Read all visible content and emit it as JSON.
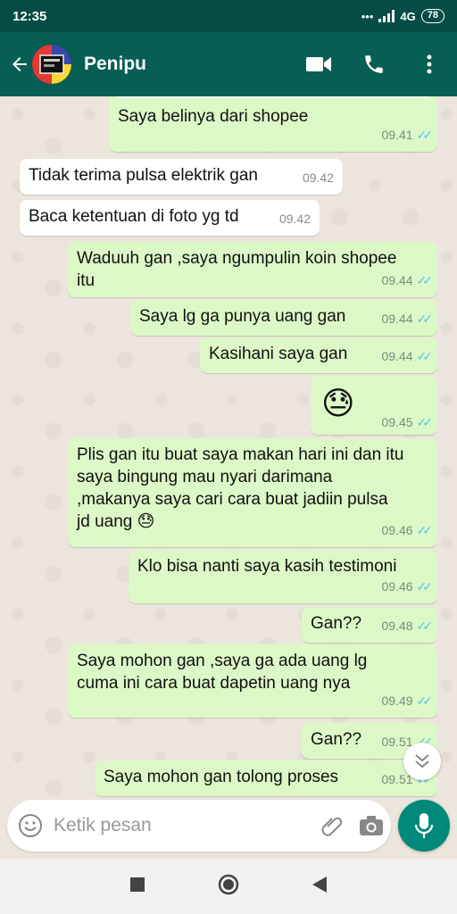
{
  "status_bar": {
    "time": "12:35",
    "network": "4G",
    "battery": "78"
  },
  "app_bar": {
    "contact_name": "Penipu"
  },
  "icons": {
    "back": "arrow-left-icon",
    "video": "video-call-icon",
    "call": "phone-icon",
    "menu": "more-vert-icon",
    "emoji": "emoji-icon",
    "attach": "paperclip-icon",
    "camera": "camera-icon",
    "mic": "mic-icon",
    "scroll_down": "double-chevron-down-icon"
  },
  "colors": {
    "header": "#075e54",
    "outgoing": "#dcf8c6",
    "incoming": "#ffffff",
    "ticks": "#4fc3f7",
    "mic": "#00897b"
  },
  "messages": [
    {
      "direction": "out",
      "text": "Saya belinya dari shopee",
      "time": "09.41",
      "read": true
    },
    {
      "direction": "in",
      "text": "Tidak terima pulsa elektrik gan",
      "time": "09.42"
    },
    {
      "direction": "in",
      "text": "Baca ketentuan di foto yg td",
      "time": "09.42"
    },
    {
      "direction": "out",
      "text": "Waduuh gan ,saya ngumpulin koin shopee itu",
      "time": "09.44",
      "read": true
    },
    {
      "direction": "out",
      "text": "Saya lg ga punya uang gan",
      "time": "09.44",
      "read": true
    },
    {
      "direction": "out",
      "text": "Kasihani saya gan",
      "time": "09.44",
      "read": true
    },
    {
      "direction": "out",
      "text": "😓",
      "time": "09.45",
      "read": true
    },
    {
      "direction": "out",
      "text": "Plis gan itu buat saya makan hari ini dan itu saya bingung mau nyari darimana ,makanya saya cari cara buat jadiin pulsa jd uang 😓",
      "time": "09.46",
      "read": true
    },
    {
      "direction": "out",
      "text": "Klo bisa nanti saya kasih testimoni",
      "time": "09.46",
      "read": true
    },
    {
      "direction": "out",
      "text": "Gan??",
      "time": "09.48",
      "read": true
    },
    {
      "direction": "out",
      "text": "Saya mohon gan ,saya ga ada uang lg cuma ini cara buat dapetin uang nya",
      "time": "09.49",
      "read": true
    },
    {
      "direction": "out",
      "text": "Gan??",
      "time": "09.51",
      "read": true
    },
    {
      "direction": "out",
      "text": "Saya mohon gan tolong proses",
      "time": "09.51",
      "read": true
    }
  ],
  "composer": {
    "placeholder": "Ketik pesan"
  }
}
